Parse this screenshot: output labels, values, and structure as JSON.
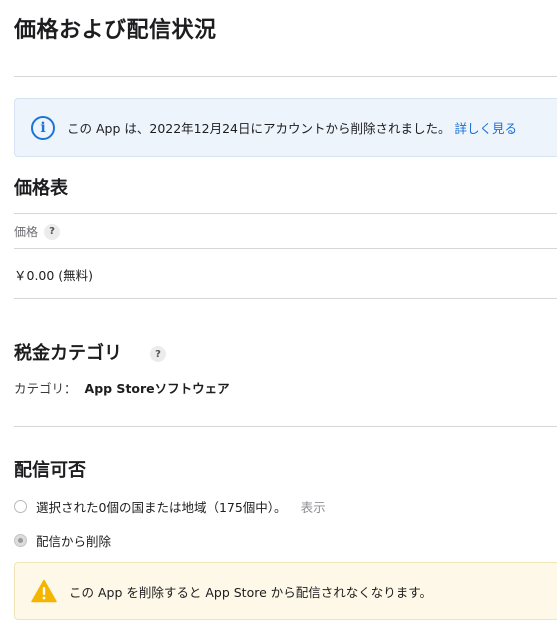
{
  "page": {
    "title": "価格および配信状況"
  },
  "notice": {
    "icon": "info-icon",
    "text": "この App は、2022年12月24日にアカウントから削除されました。",
    "link": "詳しく見る",
    "accent_color": "#1b74d6"
  },
  "price_schedule": {
    "title": "価格表",
    "label": "価格",
    "help": "?",
    "value": "￥0.00 (無料)"
  },
  "tax_category": {
    "title": "税金カテゴリ",
    "help": "?",
    "label": "カテゴリ：",
    "value": "App Storeソフトウェア"
  },
  "availability": {
    "title": "配信可否",
    "options": [
      {
        "label": "選択された0個の国または地域（175個中）。",
        "link": "表示",
        "selected": false
      },
      {
        "label": "配信から削除",
        "selected": true
      }
    ]
  },
  "warning": {
    "icon": "warning-icon",
    "text": "この App を削除すると App Store から配信されなくなります。",
    "accent_color": "#f4b400"
  }
}
